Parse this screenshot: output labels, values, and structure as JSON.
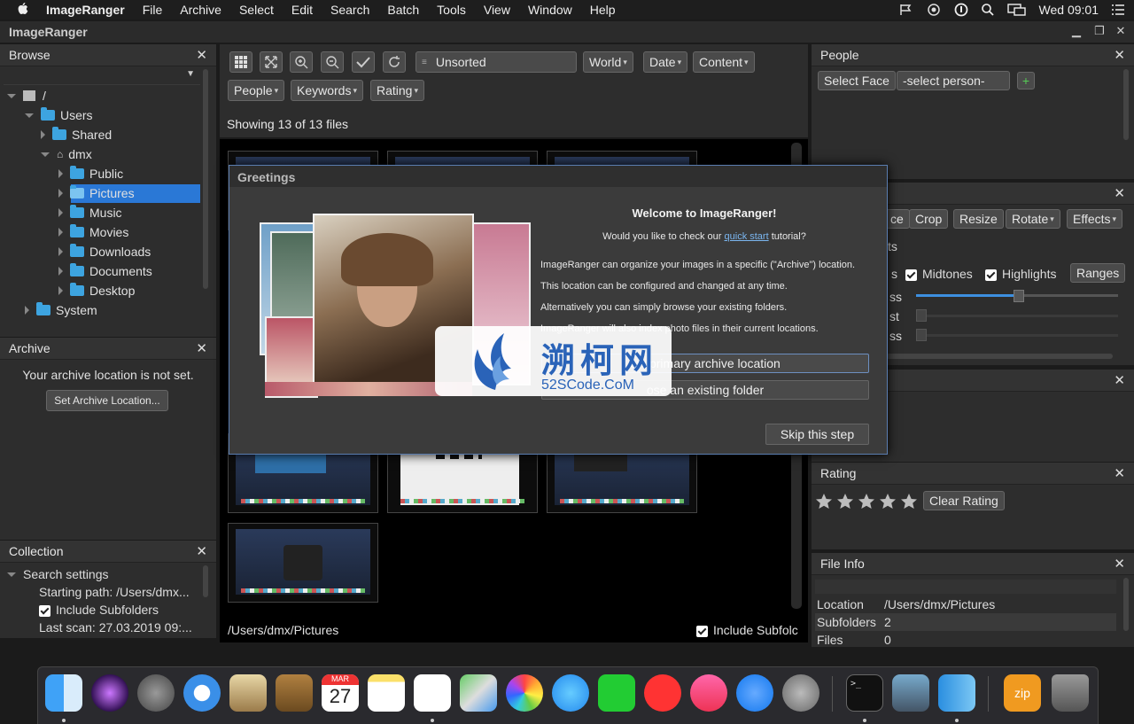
{
  "menubar": {
    "app": "ImageRanger",
    "items": [
      "File",
      "Archive",
      "Select",
      "Edit",
      "Search",
      "Batch",
      "Tools",
      "View",
      "Window",
      "Help"
    ],
    "clock": "Wed 09:01"
  },
  "window": {
    "title": "ImageRanger"
  },
  "browse": {
    "title": "Browse",
    "tree": [
      "/",
      "Users",
      "Shared",
      "dmx",
      "Public",
      "Pictures",
      "Music",
      "Movies",
      "Downloads",
      "Documents",
      "Desktop",
      "System"
    ]
  },
  "archive": {
    "title": "Archive",
    "message": "Your archive location is not set.",
    "button": "Set Archive Location..."
  },
  "collection": {
    "title": "Collection",
    "search_settings": "Search settings",
    "starting_path": "Starting path: /Users/dmx...",
    "include_subfolders": "Include Subfolders",
    "last_scan": "Last scan: 27.03.2019 09:..."
  },
  "toolbar": {
    "sort": "Unsorted",
    "world": "World",
    "date": "Date",
    "content": "Content",
    "people": "People",
    "keywords": "Keywords",
    "rating": "Rating"
  },
  "grid": {
    "status": "Showing 13 of 13 files",
    "path": "/Users/dmx/Pictures",
    "include_subfolders": "Include Subfolc"
  },
  "dialog": {
    "title": "Greetings",
    "heading": "Welcome to ImageRanger!",
    "question_pre": "Would you like to check our ",
    "question_link": "quick start",
    "question_post": " tutorial?",
    "line1": "ImageRanger can organize your images in a specific (\"Archive\") location.",
    "line2": "This location can be configured and changed at any time.",
    "line3": "Alternatively you can simply browse your existing folders.",
    "line4": "ImageRanger will also index photo files in their current locations.",
    "btn_new": "ew primary archive location",
    "btn_existing": "ose an existing folder",
    "btn_skip": "Skip this step"
  },
  "watermark": {
    "cn": "溯柯网",
    "en": "52SCode.CoM"
  },
  "people": {
    "title": "People",
    "select_face": "Select Face",
    "select_person": "-select person-",
    "add": "+"
  },
  "adjust": {
    "b1": "ce",
    "crop": "Crop",
    "resize": "Resize",
    "rotate": "Rotate",
    "effects": "Effects",
    "row_label": "ts",
    "cut_s": "s",
    "midtones": "Midtones",
    "highlights": "Highlights",
    "ranges": "Ranges",
    "s1": "ss",
    "s2": "st",
    "s3": "ss"
  },
  "rating": {
    "title": "Rating",
    "value": 0,
    "max": 5,
    "clear": "Clear Rating"
  },
  "fileinfo": {
    "title": "File Info",
    "rows": [
      {
        "k": "Location",
        "v": "/Users/dmx/Pictures"
      },
      {
        "k": "Subfolders",
        "v": "2"
      },
      {
        "k": "Files",
        "v": "0"
      }
    ]
  },
  "colors": {
    "accent": "#2a78d6",
    "folder": "#3da4e0",
    "dialog_border": "#5a7db0"
  },
  "dock": {
    "calendar_month": "MAR",
    "calendar_day": "27",
    "zip": "zip"
  }
}
